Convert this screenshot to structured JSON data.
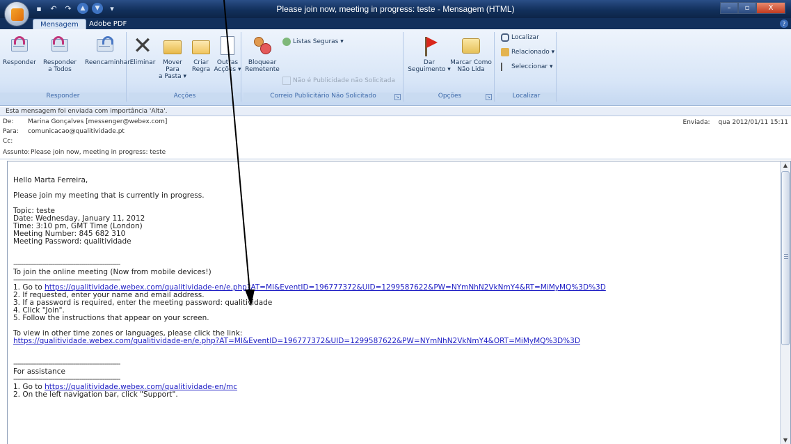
{
  "window": {
    "title": "Please join now, meeting in progress: teste - Mensagem (HTML)",
    "controls": {
      "minimize": "–",
      "maximize": "▫",
      "close": "X"
    }
  },
  "tabs": [
    {
      "label": "Mensagem",
      "active": true
    },
    {
      "label": "Adobe PDF",
      "active": false
    }
  ],
  "ribbon": {
    "responder": {
      "label": "Responder",
      "buttons": [
        {
          "line1": "Responder",
          "line2": ""
        },
        {
          "line1": "Responder",
          "line2": "a Todos"
        },
        {
          "line1": "Reencaminhar",
          "line2": ""
        }
      ]
    },
    "accoes": {
      "label": "Acções",
      "buttons": [
        {
          "line1": "Eliminar",
          "line2": ""
        },
        {
          "line1": "Mover Para",
          "line2": "a Pasta ▾"
        },
        {
          "line1": "Criar",
          "line2": "Regra"
        },
        {
          "line1": "Outras",
          "line2": "Acções ▾"
        }
      ]
    },
    "correio": {
      "label": "Correio Publicitário Não Solicitado",
      "block_line1": "Bloquear",
      "block_line2": "Remetente",
      "safe_lists": "Listas Seguras ▾",
      "not_junk": "Não é Publicidade não Solicitada"
    },
    "opcoes": {
      "label": "Opções",
      "buttons": [
        {
          "line1": "Dar",
          "line2": "Seguimento ▾"
        },
        {
          "line1": "Marcar Como",
          "line2": "Não Lida"
        }
      ]
    },
    "localizar": {
      "label": "Localizar",
      "items": [
        "Localizar",
        "Relacionado ▾",
        "Seleccionar ▾"
      ]
    }
  },
  "infobar": "Esta mensagem foi enviada com importância 'Alta'.",
  "header": {
    "from_label": "De:",
    "from": "Marina Gonçalves [messenger@webex.com]",
    "to_label": "Para:",
    "to": "comunicacao@qualitividade.pt",
    "cc_label": "Cc:",
    "cc": "",
    "subject_label": "Assunto:",
    "subject": "Please join now, meeting in progress: teste",
    "sent_label": "Enviada:",
    "sent": "qua 2012/01/11 15:11"
  },
  "body": {
    "greeting": "Hello Marta Ferreira,",
    "intro": "Please join my meeting that is currently in progress.",
    "topic": "Topic: teste",
    "date": "Date: Wednesday, January 11, 2012",
    "time": "Time: 3:10 pm, GMT Time (London)",
    "number": "Meeting Number: 845 682 310",
    "password": "Meeting Password: qualitividade",
    "divider": "-------------------------------------------------------",
    "join_heading": "To join the online meeting (Now from mobile devices!)",
    "step1_prefix": "1. Go to ",
    "step1_link": "https://qualitividade.webex.com/qualitividade-en/e.php?AT=MI&EventID=196777372&UID=1299587622&PW=NYmNhN2VkNmY4&RT=MiMyMQ%3D%3D",
    "step2": "2. If requested, enter your name and email address.",
    "step3": "3. If a password is required, enter the meeting password: qualitividade",
    "step4": "4. Click \"Join\".",
    "step5": "5. Follow the instructions that appear on your screen.",
    "timezones": "To view in other time zones or languages, please click the link:",
    "timezones_link": "https://qualitividade.webex.com/qualitividade-en/e.php?AT=MI&EventID=196777372&UID=1299587622&PW=NYmNhN2VkNmY4&ORT=MiMyMQ%3D%3D",
    "assistance_heading": "For assistance",
    "assist1_prefix": "1. Go to ",
    "assist1_link": "https://qualitividade.webex.com/qualitividade-en/mc",
    "assist2": "2. On the left navigation bar, click \"Support\"."
  }
}
